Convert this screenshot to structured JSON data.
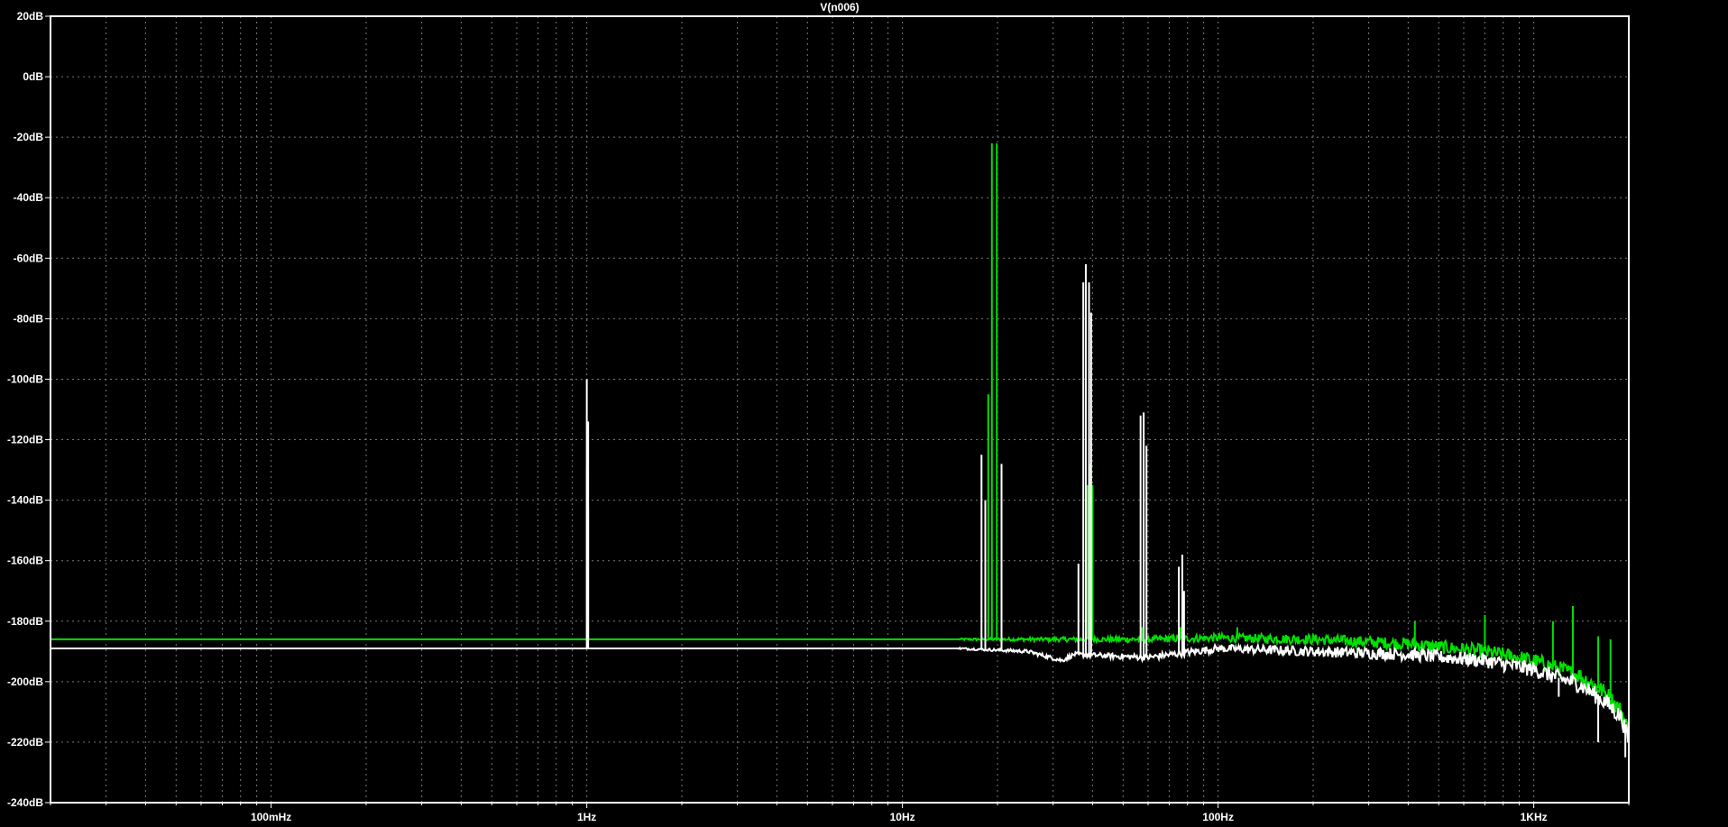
{
  "chart_data": {
    "type": "line",
    "title": "V(n006)",
    "xlabel": "",
    "ylabel": "",
    "xscale": "log",
    "xlim": [
      0.02,
      2000
    ],
    "ylim": [
      -240,
      20
    ],
    "grid": true,
    "x_ticks": [
      {
        "value": 0.1,
        "label": "100mHz"
      },
      {
        "value": 1,
        "label": "1Hz"
      },
      {
        "value": 10,
        "label": "10Hz"
      },
      {
        "value": 100,
        "label": "100Hz"
      },
      {
        "value": 1000,
        "label": "1KHz"
      }
    ],
    "y_ticks": [
      {
        "value": 20,
        "label": "20dB"
      },
      {
        "value": 0,
        "label": "0dB"
      },
      {
        "value": -20,
        "label": "-20dB"
      },
      {
        "value": -40,
        "label": "-40dB"
      },
      {
        "value": -60,
        "label": "-60dB"
      },
      {
        "value": -80,
        "label": "-80dB"
      },
      {
        "value": -100,
        "label": "-100dB"
      },
      {
        "value": -120,
        "label": "-120dB"
      },
      {
        "value": -140,
        "label": "-140dB"
      },
      {
        "value": -160,
        "label": "-160dB"
      },
      {
        "value": -180,
        "label": "-180dB"
      },
      {
        "value": -200,
        "label": "-200dB"
      },
      {
        "value": -220,
        "label": "-220dB"
      },
      {
        "value": -240,
        "label": "-240dB"
      }
    ],
    "series": [
      {
        "color": "#00e000",
        "baseline": [
          [
            0.02,
            -186
          ],
          [
            15,
            -186
          ],
          [
            30,
            -186
          ],
          [
            60,
            -186
          ],
          [
            100,
            -185.5
          ],
          [
            200,
            -186
          ],
          [
            400,
            -187.5
          ],
          [
            700,
            -190
          ],
          [
            1000,
            -193
          ],
          [
            1400,
            -198
          ],
          [
            1700,
            -204
          ],
          [
            1900,
            -210
          ],
          [
            2000,
            -217
          ]
        ],
        "spikes": [
          [
            1.0,
            -129
          ],
          [
            1.01,
            -142
          ],
          [
            18.7,
            -105
          ],
          [
            19.2,
            -22
          ],
          [
            19.9,
            -22
          ],
          [
            38.5,
            -135
          ],
          [
            39.2,
            -128
          ],
          [
            40,
            -135
          ],
          [
            57.5,
            -182
          ],
          [
            76,
            -182
          ],
          [
            115,
            -182
          ],
          [
            420,
            -180
          ],
          [
            700,
            -178
          ],
          [
            1150,
            -180
          ],
          [
            1330,
            -175
          ],
          [
            1600,
            -185
          ],
          [
            1750,
            -186
          ]
        ]
      },
      {
        "color": "#ffffff",
        "baseline": [
          [
            0.02,
            -189
          ],
          [
            15,
            -189
          ],
          [
            25,
            -190
          ],
          [
            32,
            -193
          ],
          [
            35,
            -191
          ],
          [
            60,
            -192
          ],
          [
            100,
            -189
          ],
          [
            200,
            -190
          ],
          [
            400,
            -191
          ],
          [
            700,
            -193
          ],
          [
            1000,
            -196
          ],
          [
            1400,
            -201
          ],
          [
            1700,
            -207
          ],
          [
            1900,
            -212
          ],
          [
            2000,
            -220
          ]
        ],
        "spikes": [
          [
            1.0,
            -100
          ],
          [
            1.01,
            -114
          ],
          [
            17.8,
            -125
          ],
          [
            18.3,
            -140
          ],
          [
            20.6,
            -128
          ],
          [
            36.1,
            -161
          ],
          [
            37.4,
            -68
          ],
          [
            38.1,
            -62
          ],
          [
            39.0,
            -68
          ],
          [
            39.6,
            -78
          ],
          [
            56.8,
            -112
          ],
          [
            58.1,
            -111
          ],
          [
            59.3,
            -122
          ],
          [
            75.1,
            -162
          ],
          [
            77.0,
            -158
          ],
          [
            78.0,
            -170
          ],
          [
            1200,
            -205
          ],
          [
            1600,
            -220
          ],
          [
            1950,
            -225
          ]
        ]
      }
    ]
  }
}
